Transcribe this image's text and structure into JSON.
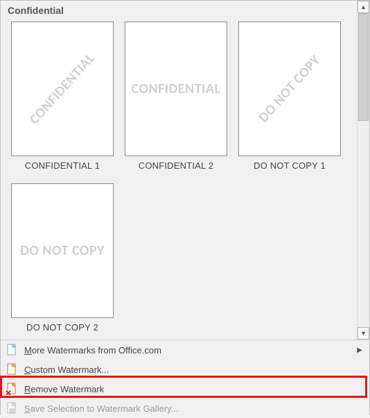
{
  "section": {
    "title": "Confidential"
  },
  "thumbnails": [
    {
      "label": "CONFIDENTIAL 1",
      "watermark": "CONFIDENTIAL",
      "orientation": "diag"
    },
    {
      "label": "CONFIDENTIAL 2",
      "watermark": "CONFIDENTIAL",
      "orientation": "horiz"
    },
    {
      "label": "DO NOT COPY 1",
      "watermark": "DO NOT COPY",
      "orientation": "diag"
    },
    {
      "label": "DO NOT COPY 2",
      "watermark": "DO NOT COPY",
      "orientation": "horiz"
    }
  ],
  "menu": {
    "more": {
      "prefix": "M",
      "rest": "ore Watermarks from Office.com"
    },
    "custom": {
      "prefix": "C",
      "rest": "ustom Watermark..."
    },
    "remove": {
      "prefix": "R",
      "rest": "emove Watermark"
    },
    "save": {
      "prefix": "S",
      "rest": "ave Selection to Watermark Gallery..."
    }
  },
  "icons": {
    "page": "page-icon",
    "page_red": "page-red-icon",
    "page_lock": "page-lock-icon"
  }
}
